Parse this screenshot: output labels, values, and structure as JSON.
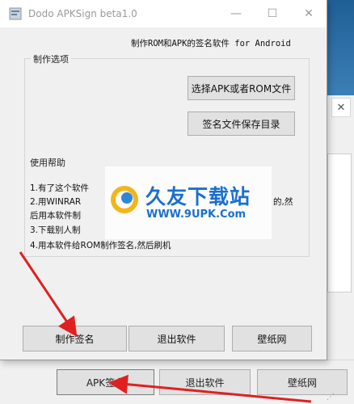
{
  "window": {
    "title": "Dodo APKSign beta1.0",
    "subtitle": "制作ROM和APK的签名软件 for Android",
    "minimize_glyph": "—",
    "maximize_glyph": "☐",
    "close_glyph": "✕"
  },
  "options": {
    "legend": "制作选项",
    "select_button": "选择APK或者ROM文件",
    "savedir_button": "签名文件保存目录"
  },
  "help": {
    "title": "使用帮助",
    "lines": [
      "1.有了这个软件",
      "2.用WINRAR",
      "后用本软件制",
      "3.下载别人制",
      "4.用本软件给ROM制作签名,然后刷机"
    ],
    "line2_tail": "的,然"
  },
  "bottom_buttons": {
    "make": "制作签名",
    "exit": "退出软件",
    "wallpaper": "壁纸网"
  },
  "background_window": {
    "apk_button": "APK签名",
    "exit_button": "退出软件",
    "wallpaper_button": "壁纸网",
    "close_glyph": "✕"
  },
  "watermark": {
    "brand": "久友下载站",
    "url": "WWW.9UPK.Com"
  },
  "colors": {
    "arrow": "#e02020",
    "brand_blue": "#1a6fd0",
    "title_gray": "#9a9a9a"
  }
}
